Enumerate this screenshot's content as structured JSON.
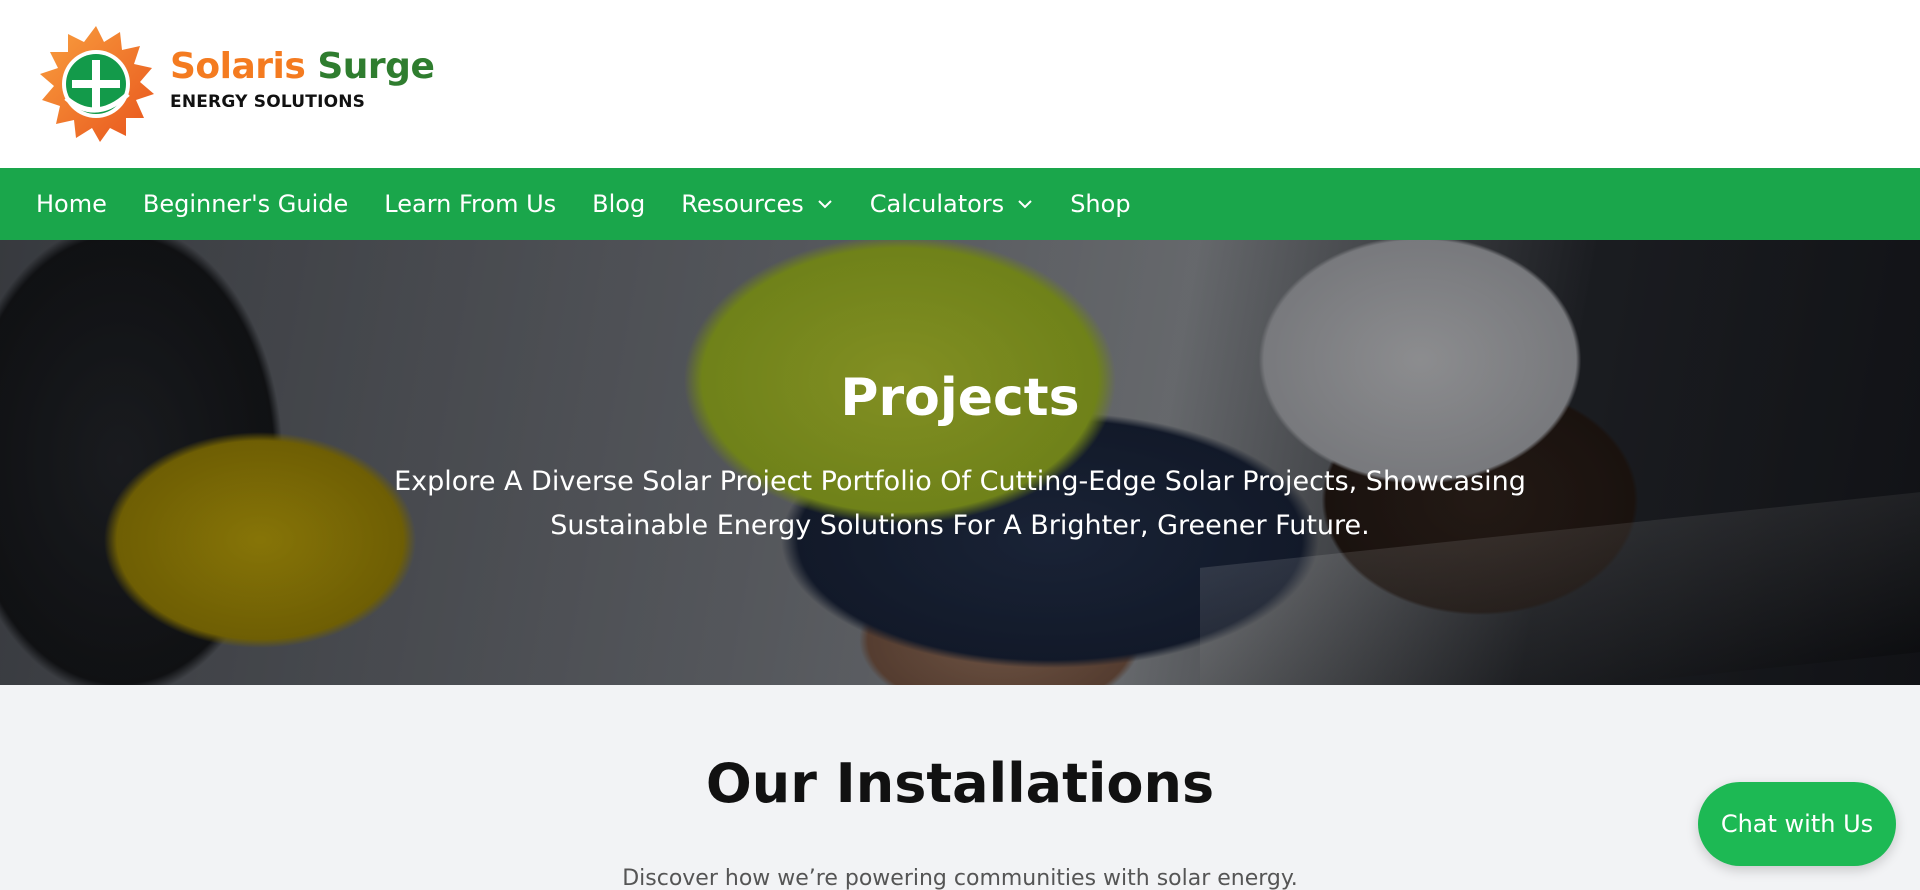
{
  "header": {
    "brand_first": "Solaris",
    "brand_second": "Surge",
    "tagline": "ENERGY SOLUTIONS",
    "logo_icon": "sun-logo-icon"
  },
  "nav": {
    "items": [
      {
        "label": "Home",
        "has_dropdown": false
      },
      {
        "label": "Beginner's Guide",
        "has_dropdown": false
      },
      {
        "label": "Learn From Us",
        "has_dropdown": false
      },
      {
        "label": "Blog",
        "has_dropdown": false
      },
      {
        "label": "Resources",
        "has_dropdown": true
      },
      {
        "label": "Calculators",
        "has_dropdown": true
      },
      {
        "label": "Shop",
        "has_dropdown": false
      }
    ]
  },
  "hero": {
    "title": "Projects",
    "subtitle": "Explore A Diverse Solar Project Portfolio Of Cutting-Edge Solar Projects, Showcasing Sustainable Energy Solutions For A Brighter, Greener Future."
  },
  "installations": {
    "title": "Our Installations",
    "subtitle": "Discover how we’re powering communities with solar energy."
  },
  "chat": {
    "label": "Chat with Us"
  },
  "colors": {
    "nav_green": "#1aa64b",
    "brand_orange": "#f47b20",
    "brand_green": "#2f7d2f",
    "chat_green": "#1db954"
  }
}
